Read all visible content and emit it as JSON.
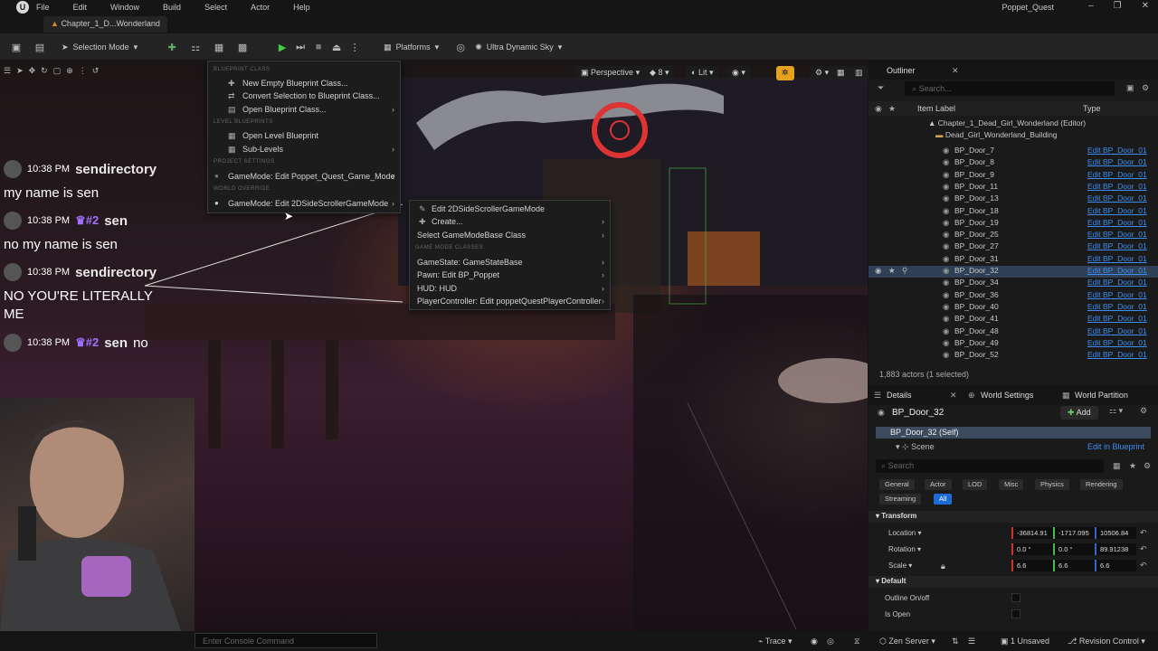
{
  "menubar": {
    "items": [
      "File",
      "Edit",
      "Window",
      "Build",
      "Select",
      "Actor",
      "Help"
    ],
    "project": "Poppet_Quest"
  },
  "tab": {
    "level": "Chapter_1_D...Wonderland"
  },
  "toolbar": {
    "mode": "Selection Mode",
    "platforms": "Platforms",
    "sky": "Ultra Dynamic Sky"
  },
  "viewport": {
    "perspective": "Perspective",
    "lit": "Lit",
    "fov": "8"
  },
  "bp_menu": {
    "h_blueprint": "BLUEPRINT CLASS",
    "new_empty": "New Empty Blueprint Class...",
    "convert": "Convert Selection to Blueprint Class...",
    "open_class": "Open Blueprint Class...",
    "h_level": "LEVEL BLUEPRINTS",
    "open_level": "Open Level Blueprint",
    "sublevels": "Sub-Levels",
    "h_project": "PROJECT SETTINGS",
    "gm_project": "GameMode: Edit Poppet_Quest_Game_Mode",
    "h_world": "WORLD OVERRIDE",
    "gm_world": "GameMode: Edit 2DSideScrollerGameMode"
  },
  "gm_menu": {
    "edit": "Edit 2DSideScrollerGameMode",
    "create": "Create...",
    "select_base": "Select GameModeBase Class",
    "h_classes": "GAME MODE CLASSES",
    "gamestate": "GameState: GameStateBase",
    "pawn": "Pawn: Edit BP_Poppet",
    "hud": "HUD: HUD",
    "pc": "PlayerController: Edit poppetQuestPlayerController"
  },
  "chat": {
    "r1_time": "10:38 PM",
    "r1_user": "sendirectory",
    "r1_msg": "my name is sen",
    "r2_time": "10:38 PM",
    "r2_badge": "♛#2",
    "r2_user": "sen",
    "r2_msg": "no my name is sen",
    "r3_time": "10:38 PM",
    "r3_user": "sendirectory",
    "r3_msg1": "NO YOU'RE LITERALLY",
    "r3_msg2": "ME",
    "r4_time": "10:38 PM",
    "r4_badge": "♛#2",
    "r4_user": "sen",
    "r4_msg": "no"
  },
  "outliner": {
    "title": "Outliner",
    "search_placeholder": "Search...",
    "col_label": "Item Label",
    "col_type": "Type",
    "root": "Chapter_1_Dead_Girl_Wonderland (Editor)",
    "folder": "Dead_Girl_Wonderland_Building",
    "rows": [
      {
        "label": "BP_Door_7",
        "type": "Edit BP_Door_01"
      },
      {
        "label": "BP_Door_8",
        "type": "Edit BP_Door_01"
      },
      {
        "label": "BP_Door_9",
        "type": "Edit BP_Door_01"
      },
      {
        "label": "BP_Door_11",
        "type": "Edit BP_Door_01"
      },
      {
        "label": "BP_Door_13",
        "type": "Edit BP_Door_01"
      },
      {
        "label": "BP_Door_18",
        "type": "Edit BP_Door_01"
      },
      {
        "label": "BP_Door_19",
        "type": "Edit BP_Door_01"
      },
      {
        "label": "BP_Door_25",
        "type": "Edit BP_Door_01"
      },
      {
        "label": "BP_Door_27",
        "type": "Edit BP_Door_01"
      },
      {
        "label": "BP_Door_31",
        "type": "Edit BP_Door_01"
      },
      {
        "label": "BP_Door_32",
        "type": "Edit BP_Door_01"
      },
      {
        "label": "BP_Door_34",
        "type": "Edit BP_Door_01"
      },
      {
        "label": "BP_Door_36",
        "type": "Edit BP_Door_01"
      },
      {
        "label": "BP_Door_40",
        "type": "Edit BP_Door_01"
      },
      {
        "label": "BP_Door_41",
        "type": "Edit BP_Door_01"
      },
      {
        "label": "BP_Door_48",
        "type": "Edit BP_Door_01"
      },
      {
        "label": "BP_Door_49",
        "type": "Edit BP_Door_01"
      },
      {
        "label": "BP_Door_52",
        "type": "Edit BP_Door_01"
      }
    ],
    "footer": "1,883 actors (1 selected)"
  },
  "details": {
    "tab_details": "Details",
    "tab_world": "World Settings",
    "tab_partition": "World Partition",
    "actor": "BP_Door_32",
    "add": "Add",
    "self": "BP_Door_32 (Self)",
    "scene": "Scene",
    "edit_bp": "Edit in Blueprint",
    "search_placeholder": "Search",
    "cats": [
      "General",
      "Actor",
      "LOD",
      "Misc",
      "Physics",
      "Rendering",
      "Streaming",
      "All"
    ],
    "transform": "Transform",
    "location": "Location",
    "loc": [
      "-36814.91",
      "-1717.095",
      "10506.84"
    ],
    "rotation": "Rotation",
    "rot": [
      "0.0 °",
      "0.0 °",
      "89.91238"
    ],
    "scale": "Scale",
    "scl": [
      "6.6",
      "6.6",
      "6.6"
    ],
    "default": "Default",
    "outline": "Outline On/off",
    "isopen": "Is Open"
  },
  "statusbar": {
    "console_placeholder": "Enter Console Command",
    "trace": "Trace",
    "zen": "Zen Server",
    "unsaved": "1 Unsaved",
    "revision": "Revision Control"
  }
}
